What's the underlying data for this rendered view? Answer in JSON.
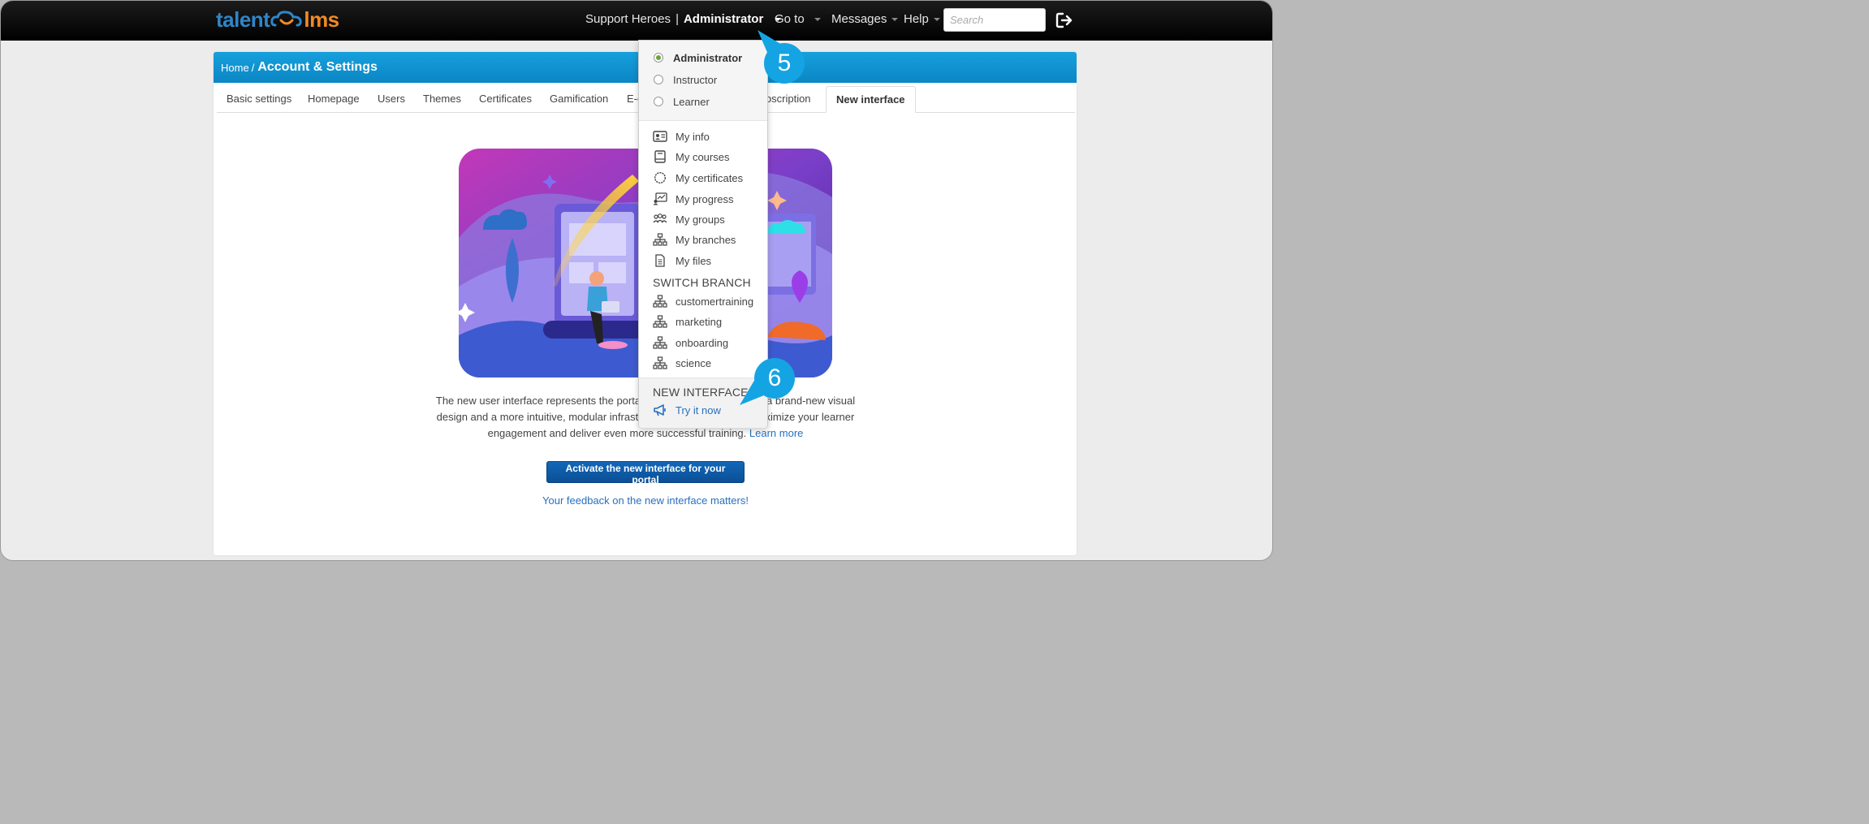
{
  "header": {
    "logo": {
      "left": "talent",
      "right": "lms"
    },
    "portal_name": "Support Heroes",
    "role": "Administrator",
    "goto": "Go to",
    "messages": "Messages",
    "help": "Help",
    "search_placeholder": "Search"
  },
  "breadcrumb": {
    "home": "Home",
    "separator": "/",
    "current": "Account & Settings"
  },
  "tabs": [
    "Basic settings",
    "Homepage",
    "Users",
    "Themes",
    "Certificates",
    "Gamification",
    "E-commerce",
    "Subscription",
    "New interface"
  ],
  "main": {
    "description_left": "The new user interface represents the portal",
    "description_right": "a brand-new visual",
    "line2_left": "design and a more intuitive, modular infrastr",
    "line2_right": "ximize your learner",
    "line3": "engagement and deliver even more successful training.",
    "learn_more": "Learn more",
    "cta": "Activate the new interface for your portal",
    "feedback": "Your feedback on the new interface matters!"
  },
  "dropdown": {
    "roles": [
      {
        "label": "Administrator",
        "selected": true
      },
      {
        "label": "Instructor",
        "selected": false
      },
      {
        "label": "Learner",
        "selected": false
      }
    ],
    "items": [
      "My info",
      "My courses",
      "My certificates",
      "My progress",
      "My groups",
      "My branches",
      "My files"
    ],
    "switch_branch_title": "SWITCH BRANCH",
    "branches": [
      "customertraining",
      "marketing",
      "onboarding",
      "science"
    ],
    "new_interface_title": "NEW INTERFACE",
    "try_now": "Try it now"
  },
  "callouts": {
    "step5": "5",
    "step6": "6"
  },
  "colors": {
    "accent": "#14a4e3",
    "link": "#2870c0",
    "header_bar": "#0b86c4",
    "radio_selected": "#6aa539"
  }
}
